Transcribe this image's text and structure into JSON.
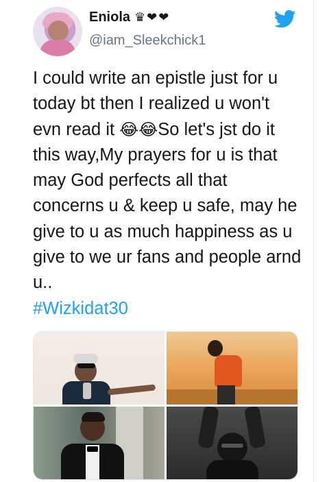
{
  "user": {
    "name": "Eniola",
    "badges": "♛❤❤",
    "handle": "@iam_Sleekchick1"
  },
  "tweet": {
    "text_before_emoji": "I could write an epistle just for u today bt then I realized u won't evn read it ",
    "emoji": "😂😂",
    "text_after_emoji": "So let's jst do it this way,My prayers for u is that may God perfects all that concerns u & keep u safe, may he give to u as much happiness as u give to we ur fans and people arnd u..",
    "hashtag": "#Wizkidat30"
  },
  "icons": {
    "brand": "twitter-bird-icon"
  },
  "colors": {
    "twitter_blue": "#1da1f2",
    "text": "#14171a",
    "secondary": "#657786"
  },
  "media": {
    "photos": [
      "photo-1",
      "photo-2",
      "photo-3",
      "photo-4"
    ]
  }
}
